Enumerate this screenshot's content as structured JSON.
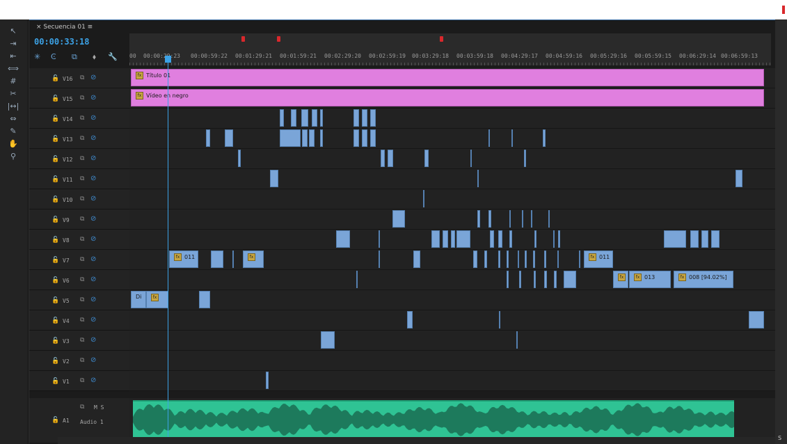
{
  "panel": {
    "tab_title": "× Secuencia 01 ≡",
    "timecode": "00:00:33:18"
  },
  "ruler": {
    "labels": [
      "00",
      "00:00:29:23",
      "00:00:59:22",
      "00:01:29:21",
      "00:01:59:21",
      "00:02:29:20",
      "00:02:59:19",
      "00:03:29:18",
      "00:03:59:18",
      "00:04:29:17",
      "00:04:59:16",
      "00:05:29:16",
      "00:05:59:15",
      "00:06:29:14",
      "00:06:59:13"
    ]
  },
  "tracks": [
    {
      "name": "V16"
    },
    {
      "name": "V15"
    },
    {
      "name": "V14"
    },
    {
      "name": "V13"
    },
    {
      "name": "V12"
    },
    {
      "name": "V11"
    },
    {
      "name": "V10"
    },
    {
      "name": "V9"
    },
    {
      "name": "V8"
    },
    {
      "name": "V7"
    },
    {
      "name": "V6"
    },
    {
      "name": "V5"
    },
    {
      "name": "V4"
    },
    {
      "name": "V3"
    },
    {
      "name": "V2"
    },
    {
      "name": "V1"
    }
  ],
  "clips": {
    "v16_title": "Título 01",
    "v15_title": "Vídeo en negro",
    "v7_a": "011",
    "v7_b": "011",
    "v6_a": "013",
    "v6_b": "008 [94.02%]",
    "v5_a": "Di"
  },
  "audio": {
    "track": "A1",
    "name": "Audio 1",
    "controls": "M S"
  },
  "scroll": {
    "right_label": "S"
  },
  "colors": {
    "video_clip": "#7aa5d8",
    "title_clip": "#e07fdf",
    "audio_clip": "#2fc394",
    "playhead": "#3ca2e6"
  }
}
